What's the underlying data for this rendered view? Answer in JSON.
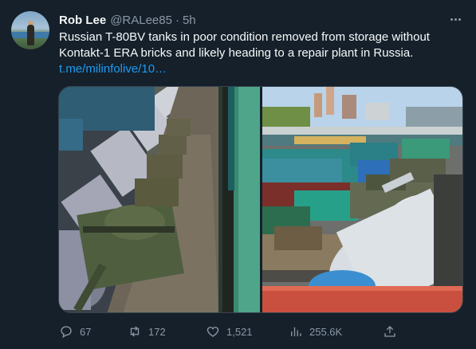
{
  "tweet": {
    "author_name": "Rob Lee",
    "handle": "@RALee85",
    "separator": "·",
    "time": "5h",
    "text": "Russian T-80BV tanks in poor condition removed from storage without Kontakt-1 ERA bricks and likely heading to a repair plant in Russia.",
    "link": "t.me/milinfolive/10…"
  },
  "media": {
    "left_image": "railway flatcars with tanks beside tanker wagons",
    "right_image": "rail yard with tanks on flatcars and colorful freight cars"
  },
  "actions": {
    "reply_count": "67",
    "retweet_count": "172",
    "like_count": "1,521",
    "views_count": "255.6K"
  },
  "icons": {
    "reply": "reply-icon",
    "retweet": "retweet-icon",
    "like": "heart-icon",
    "views": "views-icon",
    "share": "share-icon",
    "more": "more-icon"
  },
  "colors": {
    "background": "#15202b",
    "text": "#f7f9f9",
    "secondary": "#8b98a5",
    "link": "#1d9bf0"
  }
}
